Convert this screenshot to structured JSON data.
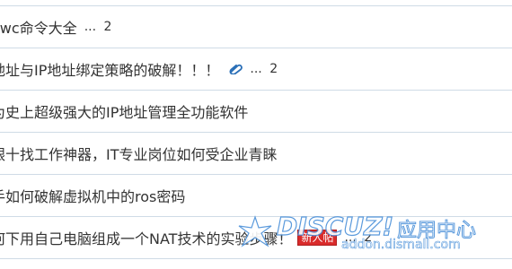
{
  "threads": [
    {
      "title": "owc命令大全",
      "attachment": false,
      "pages": {
        "ellipsis": "...",
        "last": "2"
      },
      "new_badge": ""
    },
    {
      "title": "地址与IP地址绑定策略的破解！！！",
      "attachment": true,
      "attachment_icon": "paperclip-icon",
      "pages": {
        "ellipsis": "...",
        "last": "2"
      },
      "new_badge": ""
    },
    {
      "title": "为史上超级强大的IP地址管理全功能软件",
      "attachment": false,
      "pages": null,
      "new_badge": ""
    },
    {
      "title": "银十找工作神器，IT专业岗位如何受企业青睐",
      "attachment": false,
      "pages": null,
      "new_badge": ""
    },
    {
      "title": "手如何破解虚拟机中的ros密码",
      "attachment": false,
      "pages": null,
      "new_badge": ""
    },
    {
      "title": "何下用自己电脑组成一个NAT技术的实验步骤！",
      "attachment": false,
      "pages": {
        "ellipsis": "...",
        "last": "2"
      },
      "new_badge": "新人帖"
    }
  ],
  "watermark": {
    "logo": "DISCUZ!",
    "subtitle": "应用中心",
    "url": "addon.dismall.com"
  },
  "colors": {
    "title_text": "#333333",
    "row_border": "#cfdbe6",
    "attachment_icon": "#2a6fb7",
    "new_badge_bg": "#d92b2b",
    "watermark_stroke": "#4a90d9"
  }
}
